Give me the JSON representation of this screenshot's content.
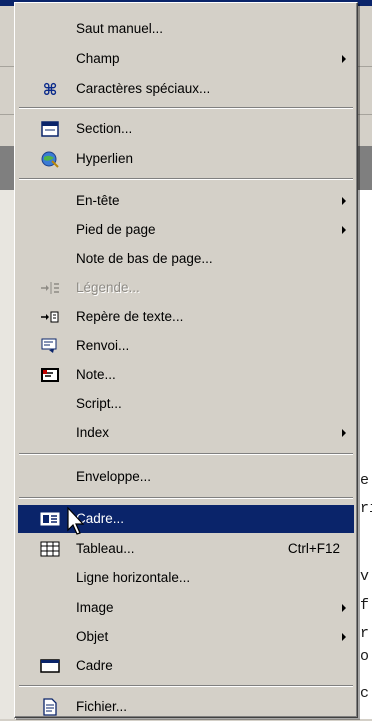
{
  "background": {
    "doc_text_fragments": [
      "e",
      "ri",
      "v",
      "f",
      "r",
      "o",
      "c"
    ]
  },
  "menu": {
    "items": [
      {
        "label": "Saut manuel...",
        "icon": "",
        "submenu": false
      },
      {
        "label": "Champ",
        "icon": "",
        "submenu": true
      },
      {
        "label": "Caractères spéciaux...",
        "icon": "special-chars-icon",
        "submenu": false
      },
      {
        "label": "Section...",
        "icon": "section-icon",
        "submenu": false
      },
      {
        "label": "Hyperlien",
        "icon": "hyperlink-icon",
        "submenu": false
      },
      {
        "label": "En-tête",
        "icon": "",
        "submenu": true
      },
      {
        "label": "Pied de page",
        "icon": "",
        "submenu": true
      },
      {
        "label": "Note de bas de page...",
        "icon": "",
        "submenu": false
      },
      {
        "label": "Légende...",
        "icon": "caption-icon",
        "submenu": false,
        "disabled": true
      },
      {
        "label": "Repère de texte...",
        "icon": "bookmark-icon",
        "submenu": false
      },
      {
        "label": "Renvoi...",
        "icon": "cross-reference-icon",
        "submenu": false
      },
      {
        "label": "Note...",
        "icon": "note-icon",
        "submenu": false
      },
      {
        "label": "Script...",
        "icon": "",
        "submenu": false
      },
      {
        "label": "Index",
        "icon": "",
        "submenu": true
      },
      {
        "label": "Enveloppe...",
        "icon": "",
        "submenu": false
      },
      {
        "label": "Cadre...",
        "icon": "frame-icon",
        "submenu": false,
        "selected": true
      },
      {
        "label": "Tableau...",
        "icon": "table-icon",
        "shortcut": "Ctrl+F12",
        "submenu": false
      },
      {
        "label": "Ligne horizontale...",
        "icon": "",
        "submenu": false
      },
      {
        "label": "Image",
        "icon": "",
        "submenu": true
      },
      {
        "label": "Objet",
        "icon": "",
        "submenu": true
      },
      {
        "label": "Cadre",
        "icon": "floating-frame-icon",
        "submenu": false
      },
      {
        "label": "Fichier...",
        "icon": "file-icon",
        "submenu": false
      }
    ]
  },
  "colors": {
    "menu_bg": "#d4d0c8",
    "highlight": "#0a246a",
    "disabled_text": "#8d8a84"
  }
}
